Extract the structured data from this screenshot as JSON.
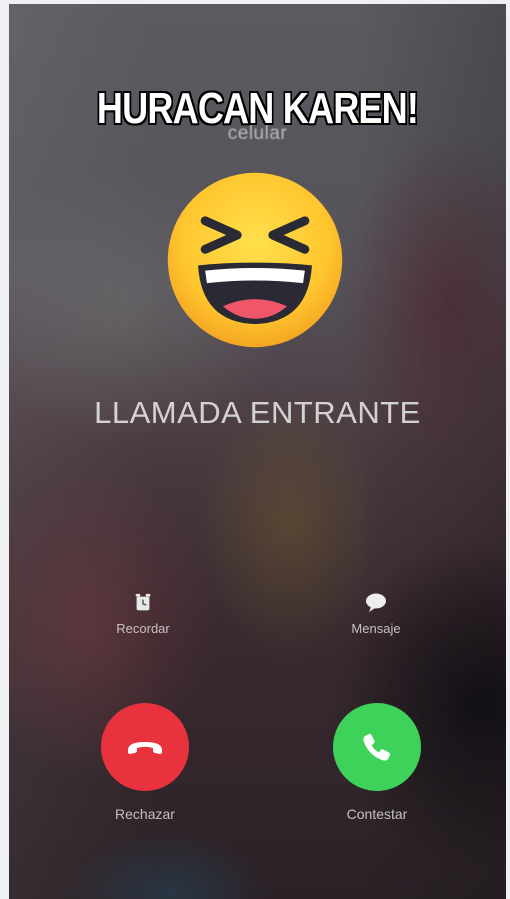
{
  "call": {
    "caller_name": "HURACAN KAREN!",
    "caller_subtitle": "celular",
    "status": "LLAMADA ENTRANTE"
  },
  "actions": {
    "remind_label": "Recordar",
    "message_label": "Mensaje"
  },
  "buttons": {
    "decline_label": "Rechazar",
    "answer_label": "Contestar"
  },
  "icons": {
    "emoji": "laughing-face-icon",
    "remind": "alarm-clock-icon",
    "message": "speech-bubble-icon",
    "decline": "hang-up-phone-icon",
    "answer": "phone-icon"
  },
  "colors": {
    "decline": "#e8333f",
    "answer": "#3fd25a",
    "emoji_yellow": "#ffcc33"
  }
}
